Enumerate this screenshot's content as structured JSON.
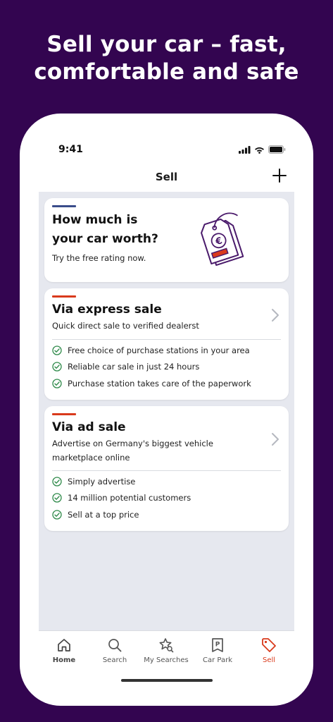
{
  "headline": {
    "line1": "Sell your car – fast,",
    "line2": "comfortable and safe"
  },
  "status_bar": {
    "time": "9:41"
  },
  "nav": {
    "title": "Sell"
  },
  "rating_card": {
    "title_line1": "How much is",
    "title_line2": "your car worth?",
    "subtitle": "Try the free rating now.",
    "accent_color": "#3a4c8a"
  },
  "express_card": {
    "title": "Via express sale",
    "subtitle": "Quick direct sale to verified dealerst",
    "accent_color": "#d93a1c",
    "features": [
      "Free choice of purchase stations in your area",
      "Reliable car sale in just 24 hours",
      "Purchase station takes care of the paperwork"
    ]
  },
  "ad_card": {
    "title": "Via ad sale",
    "subtitle_line1": "Advertise on Germany's biggest vehicle",
    "subtitle_line2": "marketplace online",
    "accent_color": "#d93a1c",
    "features": [
      "Simply advertise",
      "14 million potential customers",
      "Sell at a top price"
    ]
  },
  "tabbar": {
    "items": [
      {
        "label": "Home",
        "icon": "home-icon",
        "active": false
      },
      {
        "label": "Search",
        "icon": "search-icon",
        "active": false
      },
      {
        "label": "My Searches",
        "icon": "star-search-icon",
        "active": false
      },
      {
        "label": "Car Park",
        "icon": "parking-icon",
        "active": false
      },
      {
        "label": "Sell",
        "icon": "price-tag-icon",
        "active": true
      }
    ]
  },
  "colors": {
    "background": "#330550",
    "brand_purple": "#4a1a6b",
    "check_green": "#2f8a4a",
    "active_tab": "#d93a1c"
  }
}
